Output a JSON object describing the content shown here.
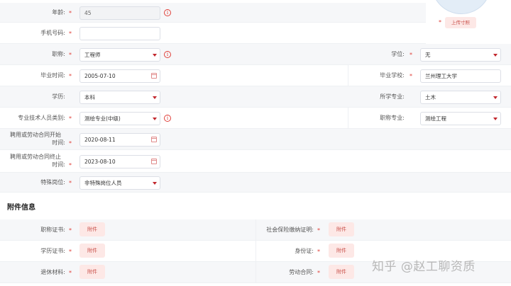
{
  "form": {
    "age": {
      "label": "年龄:",
      "value": "45"
    },
    "phone": {
      "label": "手机号码:",
      "value": ""
    },
    "title": {
      "label": "职称:",
      "value": "工程师"
    },
    "degree": {
      "label": "学位:",
      "value": "无"
    },
    "grad_date": {
      "label": "毕业时间:",
      "value": "2005-07-10"
    },
    "grad_school": {
      "label": "毕业学校:",
      "value": "兰州理工大学"
    },
    "education": {
      "label": "学历:",
      "value": "本科"
    },
    "major": {
      "label": "所学专业:",
      "value": "土木"
    },
    "tech_category": {
      "label": "专业技术人员类别:",
      "value": "测绘专业(中级)"
    },
    "title_major": {
      "label": "职称专业:",
      "value": "测绘工程"
    },
    "contract_start": {
      "label_line1": "聘用或劳动合同开始",
      "label_line2": "时间:",
      "value": "2020-08-11"
    },
    "contract_end": {
      "label_line1": "聘用或劳动合同终止",
      "label_line2": "时间:",
      "value": "2023-08-10"
    },
    "special_post": {
      "label": "特殊岗位:",
      "value": "非特殊岗位人员"
    },
    "required_mark": "*",
    "info_glyph": "i"
  },
  "photo": {
    "upload_label": "上传寸照"
  },
  "attachments": {
    "title": "附件信息",
    "button_label": "附件",
    "items": [
      {
        "label": "职称证书:"
      },
      {
        "label": "社会保险缴纳证明:"
      },
      {
        "label": "学历证书:"
      },
      {
        "label": "身份证:"
      },
      {
        "label": "退休材料:"
      },
      {
        "label": "劳动合同:"
      }
    ]
  },
  "watermark": "知乎 @赵工聊资质"
}
